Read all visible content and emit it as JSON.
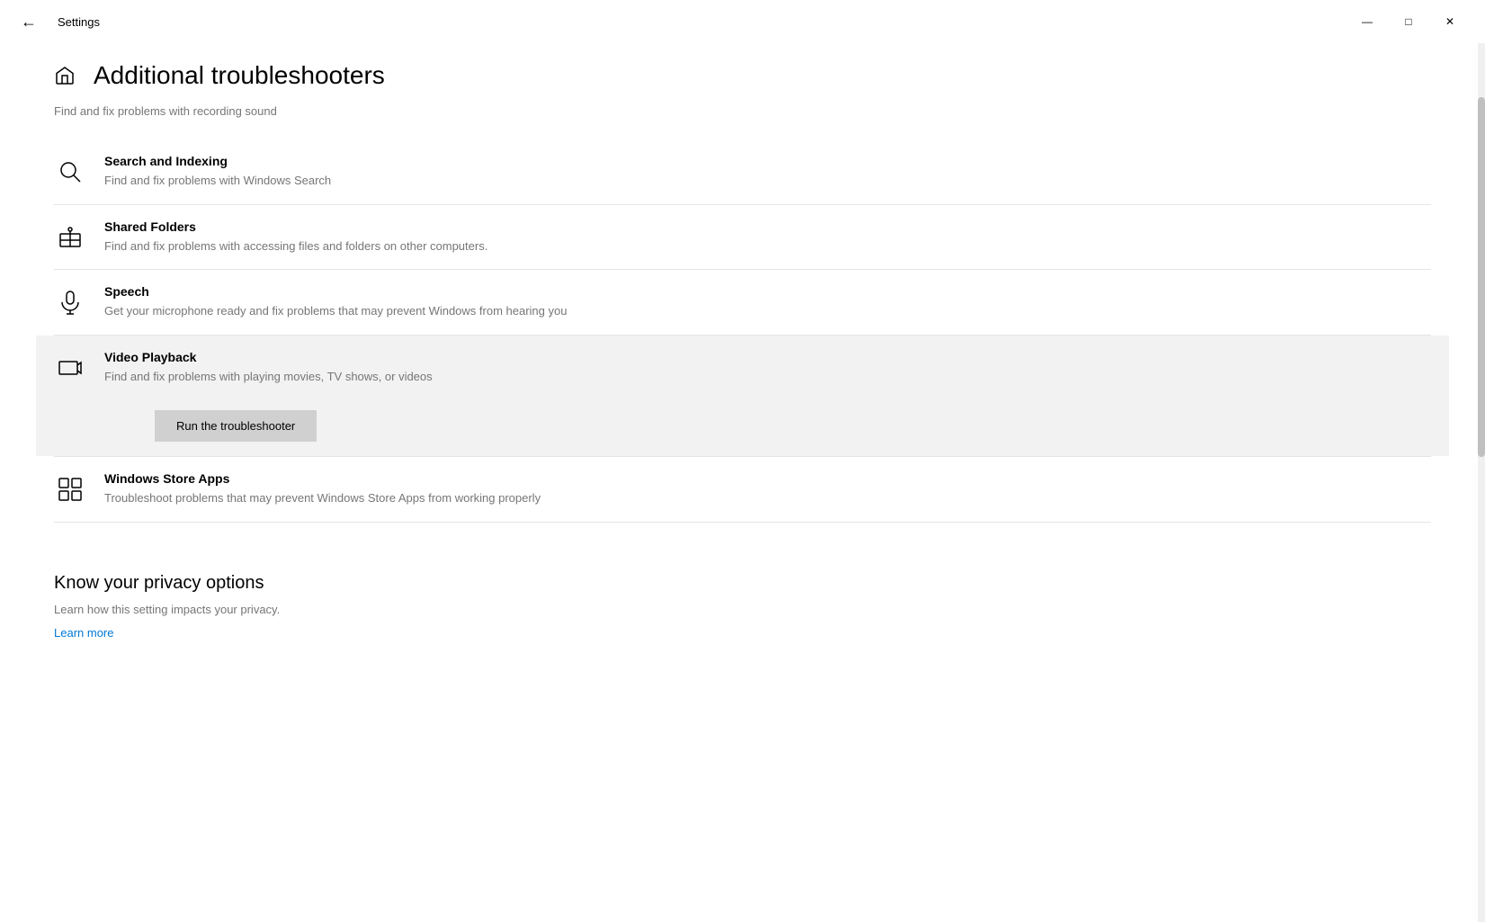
{
  "titleBar": {
    "title": "Settings",
    "minimize": "—",
    "maximize": "□",
    "close": "✕"
  },
  "page": {
    "title": "Additional troubleshooters",
    "truncatedText": "Find and fix problems with recording sound"
  },
  "items": [
    {
      "id": "search-indexing",
      "title": "Search and Indexing",
      "description": "Find and fix problems with Windows Search",
      "expanded": false
    },
    {
      "id": "shared-folders",
      "title": "Shared Folders",
      "description": "Find and fix problems with accessing files and folders on other computers.",
      "expanded": false
    },
    {
      "id": "speech",
      "title": "Speech",
      "description": "Get your microphone ready and fix problems that may prevent Windows from hearing you",
      "expanded": false
    },
    {
      "id": "video-playback",
      "title": "Video Playback",
      "description": "Find and fix problems with playing movies, TV shows, or videos",
      "expanded": true,
      "buttonLabel": "Run the troubleshooter"
    },
    {
      "id": "windows-store-apps",
      "title": "Windows Store Apps",
      "description": "Troubleshoot problems that may prevent Windows Store Apps from working properly",
      "expanded": false
    }
  ],
  "privacy": {
    "title": "Know your privacy options",
    "description": "Learn how this setting impacts your privacy.",
    "learnMore": "Learn more"
  }
}
